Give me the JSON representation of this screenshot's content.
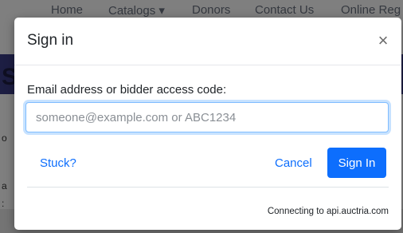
{
  "background_nav": {
    "items": [
      "Home",
      "Catalogs ▾",
      "Donors",
      "Contact Us",
      "Online Reg"
    ]
  },
  "modal": {
    "title": "Sign in",
    "close_symbol": "×",
    "close_icon": "close-icon",
    "email_label": "Email address or bidder access code:",
    "email_value": "",
    "email_placeholder": "someone@example.com or ABC1234",
    "stuck_link": "Stuck?",
    "cancel_label": "Cancel",
    "signin_label": "Sign In",
    "status": "Connecting to api.auctria.com"
  },
  "colors": {
    "primary": "#0d6efd",
    "focus_border": "#80bdff",
    "banner": "#3b3d86"
  }
}
